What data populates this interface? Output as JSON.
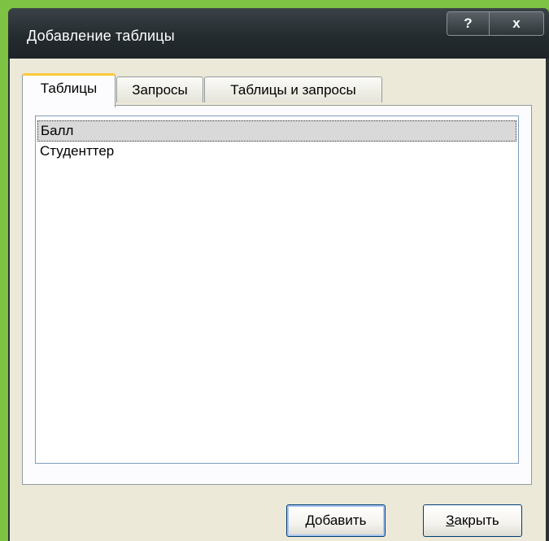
{
  "window": {
    "title": "Добавление таблицы",
    "help_label": "?",
    "close_label": "x"
  },
  "tabs": [
    {
      "label": "Таблицы",
      "active": true
    },
    {
      "label": "Запросы",
      "active": false
    },
    {
      "label": "Таблицы и запросы",
      "active": false
    }
  ],
  "list": {
    "items": [
      {
        "label": "Балл",
        "selected": true
      },
      {
        "label": "Студенттер",
        "selected": false
      }
    ]
  },
  "buttons": {
    "add": {
      "mnemonic": "Д",
      "rest": "обавить"
    },
    "close": {
      "mnemonic": "З",
      "rest": "акрыть"
    }
  },
  "colors": {
    "background": "#7dc242",
    "titlebar": "#2b3236",
    "client": "#ece9d8",
    "active_tab_accent": "#ffc83c",
    "selection": "#d9d9d9"
  }
}
